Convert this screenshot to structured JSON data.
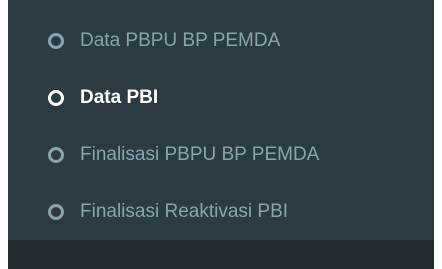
{
  "sidebar": {
    "submenu": {
      "items": [
        {
          "label": "Data PBPU BP PEMDA",
          "icon": "circle-outline-icon",
          "active": false
        },
        {
          "label": "Data PBI",
          "icon": "circle-outline-icon",
          "active": true
        },
        {
          "label": "Finalisasi PBPU BP PEMDA",
          "icon": "circle-outline-icon",
          "active": false
        },
        {
          "label": "Finalisasi Reaktivasi PBI",
          "icon": "circle-outline-icon",
          "active": false
        }
      ]
    }
  },
  "colors": {
    "panel_bg": "#2c3b41",
    "bottom_bg": "#222d32",
    "item_text": "#8aa4af",
    "active_text": "#ffffff"
  }
}
